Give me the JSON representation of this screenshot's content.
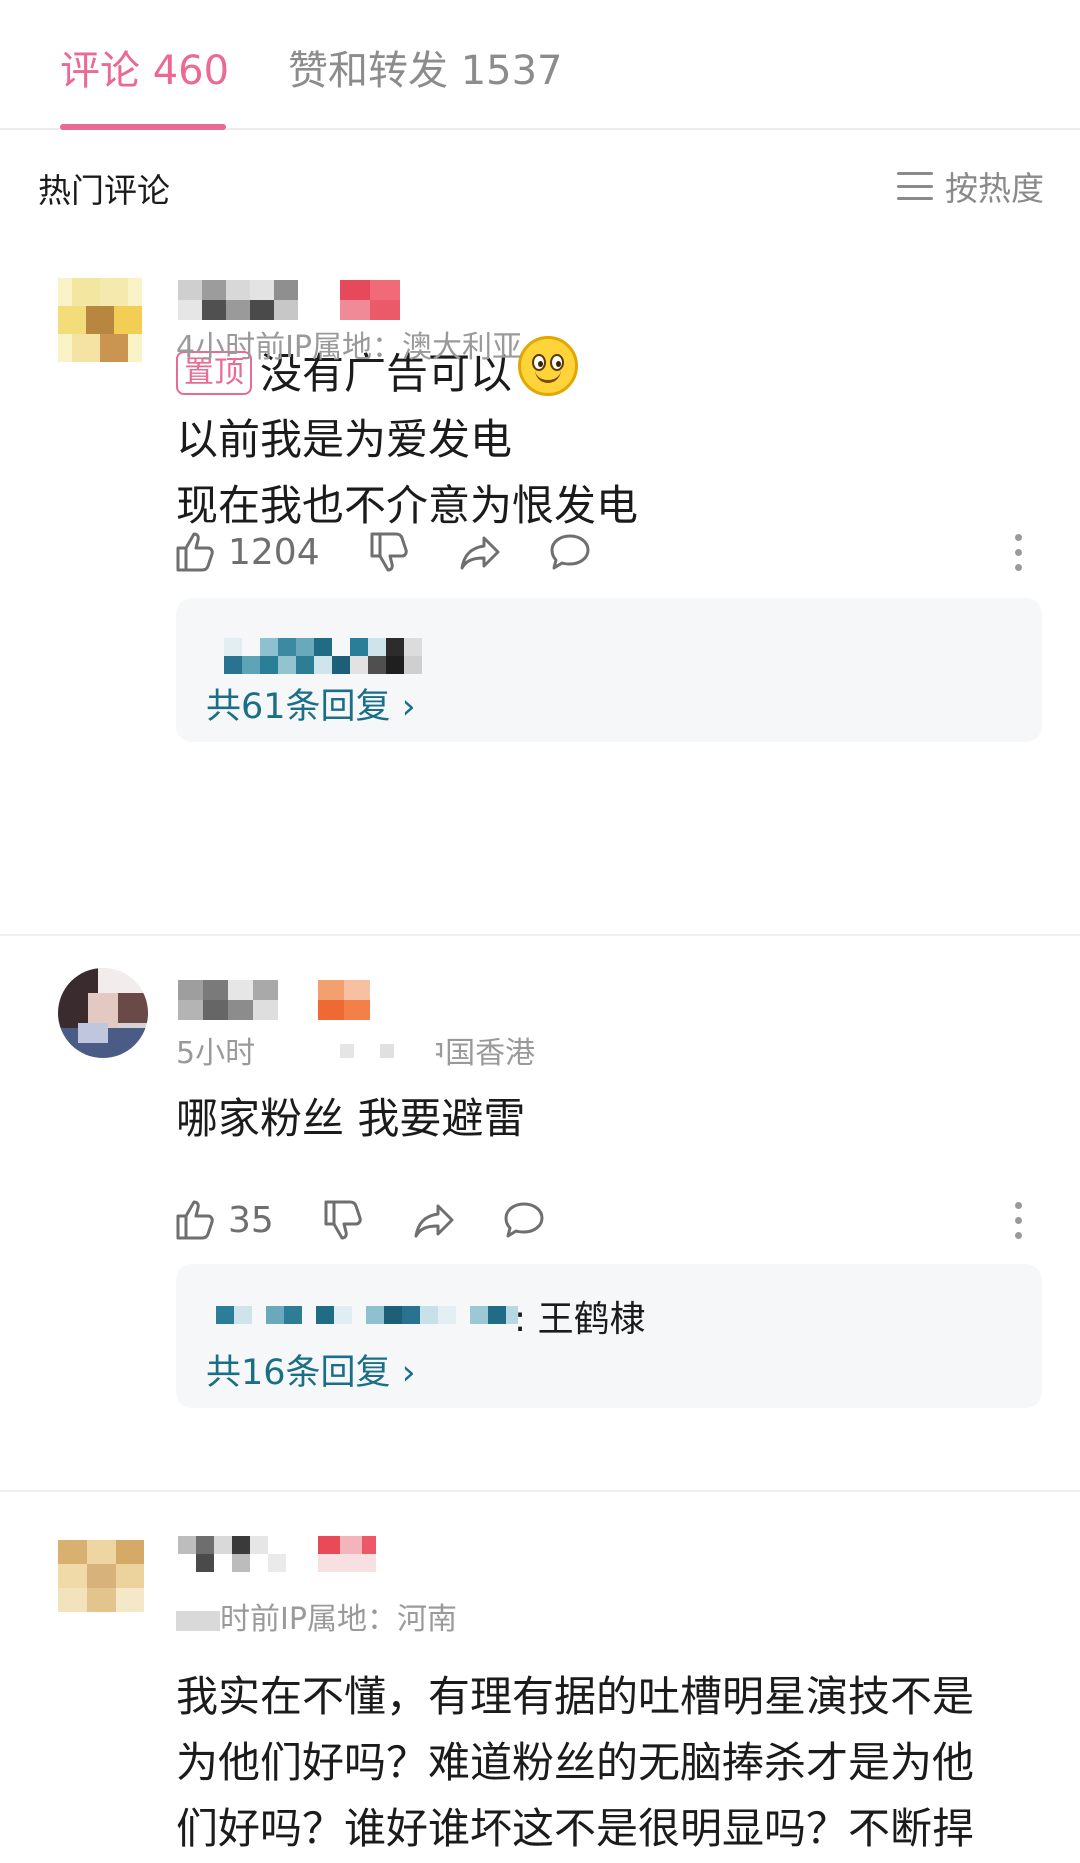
{
  "tabs": {
    "comments_label": "评论 460",
    "likes_reposts_label": "赞和转发 1537"
  },
  "section": {
    "title": "热门评论",
    "sort_label": "按热度",
    "sort_icon": "menu-lines-icon"
  },
  "comments": [
    {
      "meta": "4小时前IP属地：澳大利亚",
      "pinned_badge": "置顶",
      "lines": [
        "没有广告可以",
        "以前我是为爱发电",
        "现在我也不介意为恨发电"
      ],
      "emoji": "smiley-face-emoji",
      "like_count": "1204",
      "reply_count_label": "共61条回复 ›"
    },
    {
      "meta": "5小时前",
      "meta_suffix": "中国香港",
      "lines": [
        "哪家粉丝 我要避雷"
      ],
      "like_count": "35",
      "reply_preview_suffix": ": 王鹤棣",
      "reply_count_label": "共16条回复 ›"
    },
    {
      "meta": "时前IP属地：河南",
      "lines": [
        "我实在不懂，有理有据的吐槽明星演技不是",
        "为他们好吗？难道粉丝的无脑捧杀才是为他",
        "们好吗？谁好谁坏这不是很明显吗？不断捍"
      ]
    }
  ],
  "colors": {
    "accent_pink": "#ea6a93",
    "reply_link": "#1a6f86",
    "muted_gray": "#9a9a9a",
    "reply_bg": "#f6f7f9"
  }
}
